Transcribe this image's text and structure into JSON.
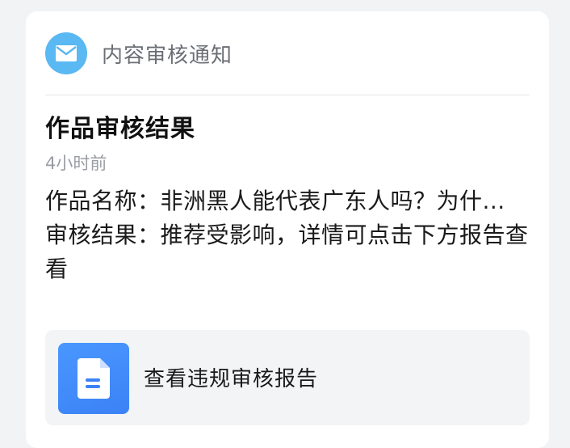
{
  "notification": {
    "category_title": "内容审核通知",
    "icon": "mail-icon"
  },
  "message": {
    "title": "作品审核结果",
    "time": "4小时前",
    "work_name_line": "作品名称：非洲黑人能代表广东人吗？为什...",
    "result_line": "审核结果：推荐受影响，详情可点击下方报告查看"
  },
  "report": {
    "icon": "document-icon",
    "label": "查看违规审核报告"
  },
  "colors": {
    "icon_circle": "#5ab8f2",
    "report_icon": "#3b82f6",
    "card_bg": "#ffffff",
    "page_bg": "#f2f3f5"
  }
}
